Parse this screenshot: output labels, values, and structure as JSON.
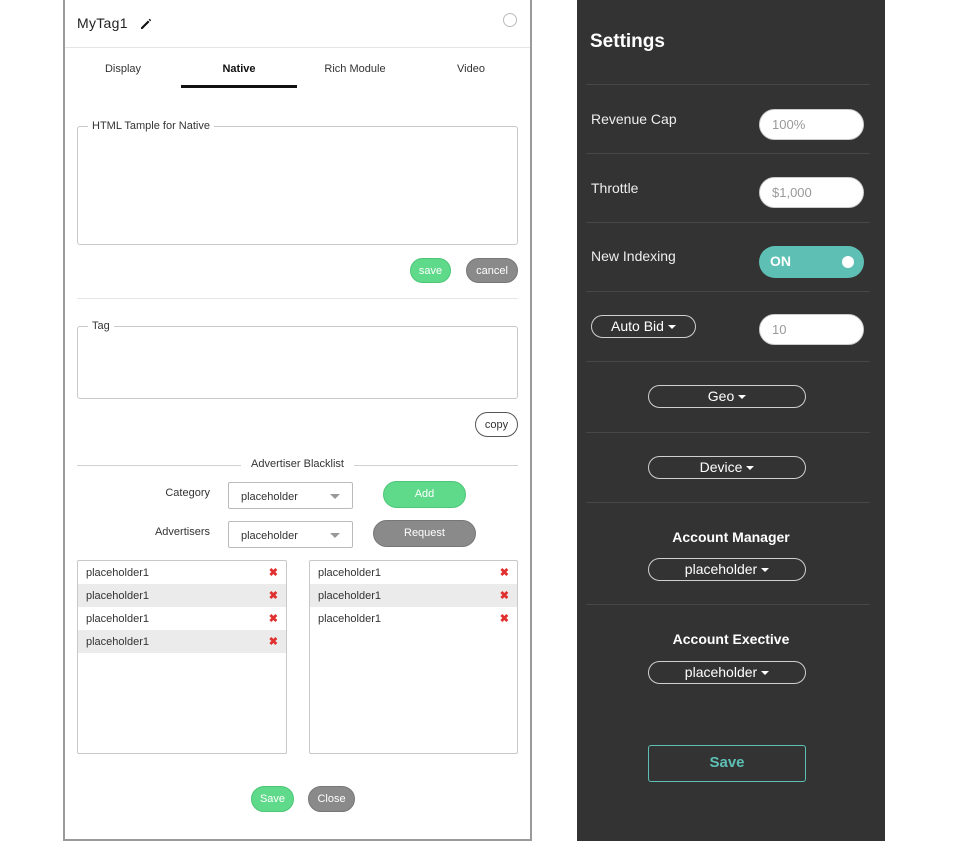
{
  "left": {
    "title": "MyTag1",
    "icons": {
      "edit": "pencil-icon",
      "status": "radio-icon"
    },
    "tabs": [
      {
        "label": "Display",
        "active": false
      },
      {
        "label": "Native",
        "active": true
      },
      {
        "label": "Rich Module",
        "active": false
      },
      {
        "label": "Video",
        "active": false
      }
    ],
    "html_template": {
      "legend": "HTML Tample for Native",
      "value": ""
    },
    "save_label": "save",
    "cancel_label": "cancel",
    "tag": {
      "legend": "Tag",
      "value": ""
    },
    "copy_label": "copy",
    "blacklist_title": "Advertiser Blacklist",
    "category": {
      "label": "Category",
      "value": "placeholder"
    },
    "add_label": "Add",
    "advertisers": {
      "label": "Advertisers",
      "value": "placeholder"
    },
    "request_label": "Request",
    "list_left": [
      "placeholder1",
      "placeholder1",
      "placeholder1",
      "placeholder1"
    ],
    "list_right": [
      "placeholder1",
      "placeholder1",
      "placeholder1"
    ],
    "remove_glyph": "✖",
    "bottom_save": "Save",
    "bottom_close": "Close"
  },
  "right": {
    "title": "Settings",
    "revenue_cap": {
      "label": "Revenue Cap",
      "placeholder": "100%"
    },
    "throttle": {
      "label": "Throttle",
      "placeholder": "$1,000"
    },
    "new_indexing": {
      "label": "New Indexing",
      "state": "ON"
    },
    "auto_bid": {
      "label": "Auto Bid",
      "placeholder": "10"
    },
    "geo_label": "Geo",
    "device_label": "Device",
    "account_manager": {
      "heading": "Account Manager",
      "value": "placeholder"
    },
    "account_executive": {
      "heading": "Account Exective",
      "value": "placeholder"
    },
    "save_label": "Save"
  },
  "colors": {
    "green": "#5fd98a",
    "gray": "#8a8a8a",
    "teal": "#5ec0b5",
    "dark_panel": "#333333",
    "remove_red": "#e03030"
  }
}
